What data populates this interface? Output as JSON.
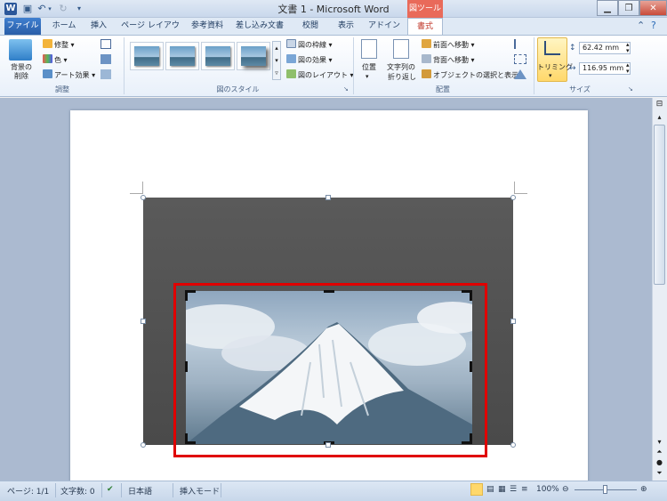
{
  "window": {
    "app_icon": "W",
    "title": "文書 1 - Microsoft Word",
    "context_tab_header": "図ツール"
  },
  "tabs": {
    "file": "ファイル",
    "items": [
      "ホーム",
      "挿入",
      "ページ レイアウト",
      "参考資料",
      "差し込み文書",
      "校閲",
      "表示",
      "アドイン"
    ],
    "active": "書式"
  },
  "ribbon": {
    "adjust": {
      "remove_bg_line1": "背景の",
      "remove_bg_line2": "削除",
      "corrections": "修整",
      "color": "色",
      "artistic": "アート効果",
      "label": "調整"
    },
    "picture_styles": {
      "border": "図の枠線",
      "effects": "図の効果",
      "layout": "図のレイアウト",
      "label": "図のスタイル"
    },
    "arrange": {
      "position": "位置",
      "wrap_line1": "文字列の",
      "wrap_line2": "折り返し",
      "bring_forward": "前面へ移動",
      "send_backward": "背面へ移動",
      "selection_pane": "オブジェクトの選択と表示",
      "label": "配置"
    },
    "size": {
      "crop": "トリミング",
      "height": "62.42 mm",
      "width": "116.95 mm",
      "label": "サイズ"
    }
  },
  "status": {
    "page": "ページ: 1/1",
    "words": "文字数: 0",
    "language": "日本語",
    "mode": "挿入モード",
    "zoom": "100%"
  },
  "colors": {
    "highlight": "#e00000",
    "accent": "#2b579a"
  }
}
